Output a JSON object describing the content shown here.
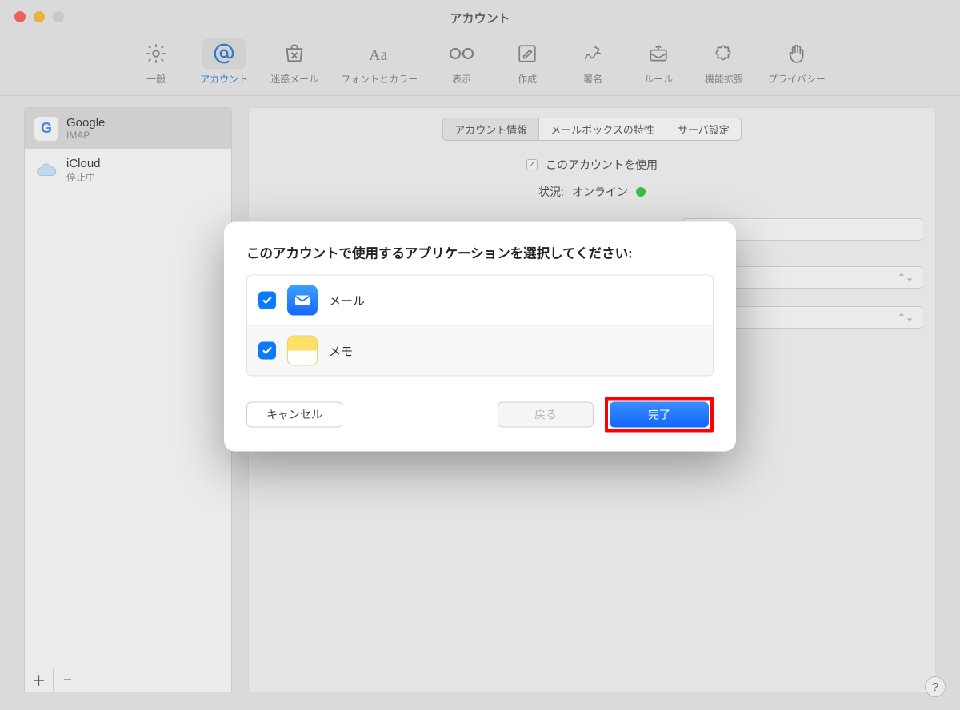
{
  "window": {
    "title": "アカウント"
  },
  "toolbar": {
    "items": [
      {
        "label": "一般"
      },
      {
        "label": "アカウント"
      },
      {
        "label": "迷惑メール"
      },
      {
        "label": "フォントとカラー"
      },
      {
        "label": "表示"
      },
      {
        "label": "作成"
      },
      {
        "label": "署名"
      },
      {
        "label": "ルール"
      },
      {
        "label": "機能拡張"
      },
      {
        "label": "プライバシー"
      }
    ]
  },
  "sidebar": {
    "accounts": [
      {
        "name": "Google",
        "sub": "IMAP"
      },
      {
        "name": "iCloud",
        "sub": "停止中"
      }
    ],
    "add": "＋",
    "remove": "−"
  },
  "tabs": {
    "items": [
      {
        "label": "アカウント情報"
      },
      {
        "label": "メールボックスの特性"
      },
      {
        "label": "サーバ設定"
      }
    ]
  },
  "form": {
    "enable_label": "このアカウントを使用",
    "status_key": "状況:",
    "status_value": "オンライン"
  },
  "dropdown_arrow": "⌃⌄",
  "modal": {
    "title": "このアカウントで使用するアプリケーションを選択してください:",
    "apps": [
      {
        "label": "メール"
      },
      {
        "label": "メモ"
      }
    ],
    "cancel": "キャンセル",
    "back": "戻る",
    "done": "完了"
  },
  "help": "?"
}
